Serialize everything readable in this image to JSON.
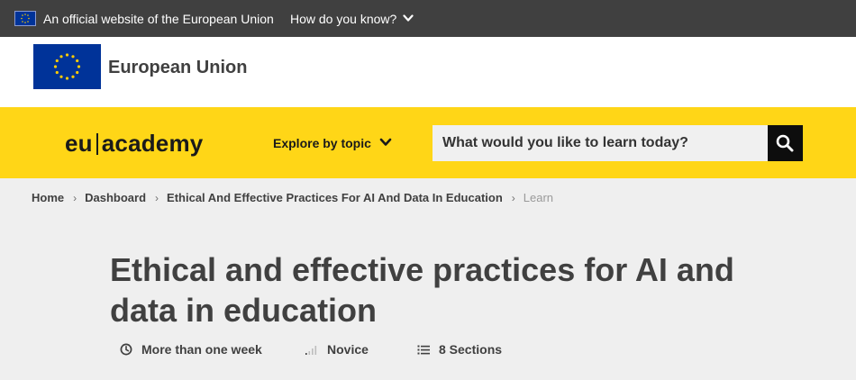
{
  "topbar": {
    "official_text": "An official website of the European Union",
    "how_know_label": "How do you know?"
  },
  "eu_header": {
    "name": "European Union"
  },
  "site_header": {
    "brand_left": "eu",
    "brand_right": "academy",
    "explore_label": "Explore by topic",
    "search_placeholder": "What would you like to learn today?",
    "accent_color": "#ffd617"
  },
  "breadcrumb": {
    "items": [
      "Home",
      "Dashboard",
      "Ethical And Effective Practices For AI And Data In Education"
    ],
    "current": "Learn"
  },
  "course": {
    "title": "Ethical and effective practices for AI and data in education",
    "duration": "More than one week",
    "level": "Novice",
    "sections": "8 Sections"
  },
  "icons": {
    "flag": "eu-flag-icon",
    "chevron": "chevron-down-icon",
    "search": "search-icon",
    "clock": "clock-icon",
    "level": "signal-bars-icon",
    "list": "list-icon"
  }
}
